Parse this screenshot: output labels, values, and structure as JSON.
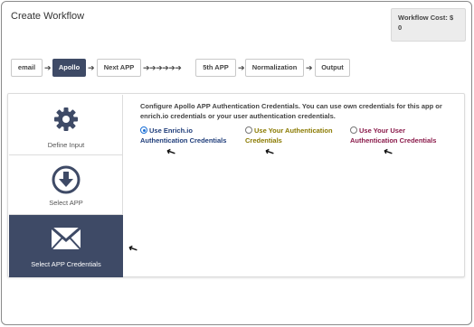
{
  "window": {
    "title": "Create Workflow"
  },
  "cost": {
    "label": "Workflow Cost: $",
    "value": "0"
  },
  "steps": {
    "items": [
      "email",
      "Apollo",
      "Next APP",
      "5th APP",
      "Normalization",
      "Output"
    ],
    "active": "Apollo",
    "arrow_single": "➔",
    "arrow_chain": "➔➔➔➔➔➔"
  },
  "sidebar": {
    "items": [
      {
        "label": "Define Input",
        "icon": "gear-icon"
      },
      {
        "label": "Select APP",
        "icon": "download-circle-icon"
      },
      {
        "label": "Select APP Credentials",
        "icon": "envelope-icon"
      }
    ],
    "active": "Select APP Credentials"
  },
  "credentials": {
    "intro": "Configure Apollo APP Authentication Credentials. You can use own credentials for this app or enrich.io credentials or your user authentication credentials.",
    "options": [
      {
        "line1": "Use Enrich.io",
        "line2": "Authentication Credentials",
        "selected": true,
        "color": "#1f3d7a"
      },
      {
        "line1": "Use Your Authentication",
        "line2": "Credentials",
        "selected": false,
        "color": "#8a7a00"
      },
      {
        "line1": "Use Your User",
        "line2": "Authentication Credentials",
        "selected": false,
        "color": "#8a1a4a"
      }
    ]
  },
  "colors": {
    "active_bg": "#3e4a66",
    "radio_on": "#1a6fd6"
  }
}
